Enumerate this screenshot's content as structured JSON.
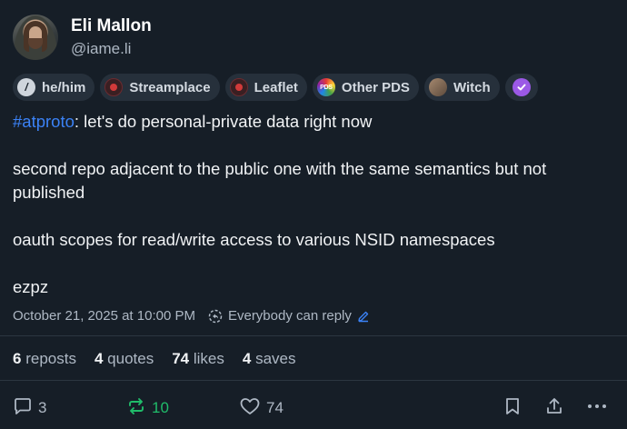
{
  "author": {
    "display_name": "Eli Mallon",
    "handle": "@iame.li",
    "avatar_icon": "avatar-photo"
  },
  "badges": [
    {
      "label": "he/him",
      "icon": "pronoun-icon"
    },
    {
      "label": "Streamplace",
      "icon": "streamplace-icon"
    },
    {
      "label": "Leaflet",
      "icon": "leaflet-icon"
    },
    {
      "label": "Other PDS",
      "icon": "pds-icon",
      "icon_text": "PDS"
    },
    {
      "label": "Witch",
      "icon": "witch-icon"
    },
    {
      "label": "",
      "icon": "verified-check-icon"
    }
  ],
  "post": {
    "hashtag": "#atproto",
    "line1_rest": ": let's do personal-private data right now",
    "paragraph2": "second repo adjacent to the public one with the same semantics but not published",
    "paragraph3": "oauth scopes for read/write access to various NSID namespaces",
    "paragraph4": "ezpz"
  },
  "meta": {
    "timestamp": "October 21, 2025 at 10:00 PM",
    "reply_setting": "Everybody can reply"
  },
  "stats": {
    "reposts_count": "6",
    "reposts_label": "reposts",
    "quotes_count": "4",
    "quotes_label": "quotes",
    "likes_count": "74",
    "likes_label": "likes",
    "saves_count": "4",
    "saves_label": "saves"
  },
  "actions": {
    "reply_count": "3",
    "repost_count": "10",
    "like_count": "74"
  },
  "colors": {
    "background": "#161e27",
    "accent_link": "#3b82f6",
    "repost_active": "#20bc6a",
    "verified": "#9b59e6"
  }
}
